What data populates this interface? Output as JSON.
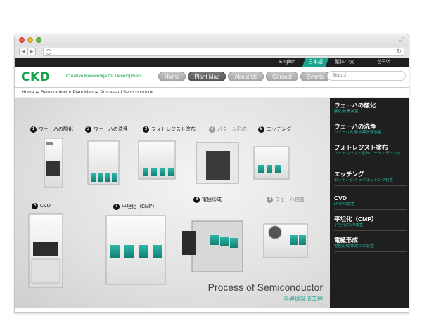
{
  "browser": {
    "back_label": "◀",
    "forward_label": "▶",
    "reload_icon": "reload-icon"
  },
  "languages": [
    {
      "label": "English",
      "active": false
    },
    {
      "label": "日本語",
      "active": true
    },
    {
      "label": "繁体中文",
      "active": false
    },
    {
      "label": "한국어",
      "active": false
    }
  ],
  "header": {
    "logo": "CKD",
    "tagline": "Creative Knowledge for Development",
    "nav": [
      {
        "label": "Home",
        "active": false
      },
      {
        "label": "Plant Map",
        "active": true
      },
      {
        "label": "About Us",
        "active": false
      },
      {
        "label": "Contact",
        "active": false
      },
      {
        "label": "Events",
        "active": false
      }
    ],
    "search_placeholder": "Search"
  },
  "breadcrumb": [
    "Home",
    "Semiconductor Plant Map",
    "Process of Semiconductor"
  ],
  "scene": {
    "labels": [
      {
        "num": "1",
        "text": "ウェーハの酸化",
        "dim": false
      },
      {
        "num": "2",
        "text": "ウェーハの洗浄",
        "dim": false
      },
      {
        "num": "3",
        "text": "フォトレジスト塗布",
        "dim": false
      },
      {
        "num": "4",
        "text": "パターン形成",
        "dim": true
      },
      {
        "num": "5",
        "text": "エッチング",
        "dim": false
      },
      {
        "num": "6",
        "text": "CVD",
        "dim": false
      },
      {
        "num": "7",
        "text": "平坦化（CMP）",
        "dim": false
      },
      {
        "num": "8",
        "text": "電極形成",
        "dim": false
      },
      {
        "num": "9",
        "text": "ウェーハ検査",
        "dim": true
      }
    ],
    "title": "Process of Semiconductor",
    "subtitle": "半導体製造工程"
  },
  "sidebar": {
    "items": [
      {
        "title": "ウェーハの酸化",
        "sub": "酸化/拡散装置"
      },
      {
        "title": "ウェーハの洗浄",
        "sub": "ウェーハ洗浄/枚葉洗浄装置"
      },
      {
        "title": "フォトレジスト塗布",
        "sub": "フォトレジスト塗布/コータ・デベロッパ"
      },
      {
        "title": "エッチング",
        "sub": "エッチング/ドライエッチング装置"
      },
      {
        "title": "CVD",
        "sub": "LPCVD装置"
      },
      {
        "title": "平坦化（CMP）",
        "sub": "平坦化/CMP装置"
      },
      {
        "title": "電極形成",
        "sub": "電極形成/枚葉CVD装置"
      }
    ]
  },
  "colors": {
    "brand": "#15a04b",
    "accent": "#1aa38f",
    "panel": "#1f1f1f"
  }
}
